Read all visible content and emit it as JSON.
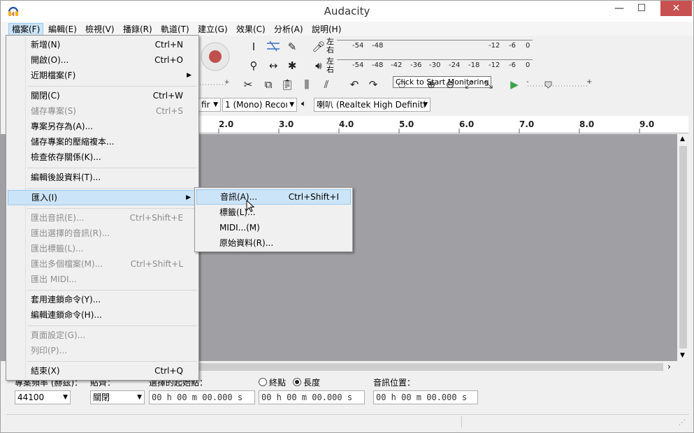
{
  "app": {
    "title": "Audacity"
  },
  "menubar": [
    {
      "label": "檔案(F)"
    },
    {
      "label": "編輯(E)"
    },
    {
      "label": "檢視(V)"
    },
    {
      "label": "播錄(R)"
    },
    {
      "label": "軌道(T)"
    },
    {
      "label": "建立(G)"
    },
    {
      "label": "效果(C)"
    },
    {
      "label": "分析(A)"
    },
    {
      "label": "說明(H)"
    }
  ],
  "file_menu": [
    {
      "label": "新增(N)",
      "shortcut": "Ctrl+N"
    },
    {
      "label": "開啟(O)...",
      "shortcut": "Ctrl+O"
    },
    {
      "label": "近期檔案(F)",
      "shortcut": ""
    },
    {
      "label": "關閉(C)",
      "shortcut": "Ctrl+W"
    },
    {
      "label": "儲存專案(S)",
      "shortcut": "Ctrl+S"
    },
    {
      "label": "專案另存為(A)...",
      "shortcut": ""
    },
    {
      "label": "儲存專案的壓縮複本...",
      "shortcut": ""
    },
    {
      "label": "檢查依存關係(K)...",
      "shortcut": ""
    },
    {
      "label": "編輯後設資料(T)...",
      "shortcut": ""
    },
    {
      "label": "匯入(I)",
      "shortcut": ""
    },
    {
      "label": "匯出音訊(E)...",
      "shortcut": "Ctrl+Shift+E"
    },
    {
      "label": "匯出選擇的音訊(R)...",
      "shortcut": ""
    },
    {
      "label": "匯出標籤(L)...",
      "shortcut": ""
    },
    {
      "label": "匯出多個檔案(M)...",
      "shortcut": "Ctrl+Shift+L"
    },
    {
      "label": "匯出 MIDI...",
      "shortcut": ""
    },
    {
      "label": "套用連鎖命令(Y)...",
      "shortcut": ""
    },
    {
      "label": "編輯連鎖命令(H)...",
      "shortcut": ""
    },
    {
      "label": "頁面設定(G)...",
      "shortcut": ""
    },
    {
      "label": "列印(P)...",
      "shortcut": ""
    },
    {
      "label": "結束(X)",
      "shortcut": "Ctrl+Q"
    }
  ],
  "import_submenu": [
    {
      "label": "音訊(A)...",
      "shortcut": "Ctrl+Shift+I"
    },
    {
      "label": "標籤(L)...",
      "shortcut": ""
    },
    {
      "label": "MIDI...(M)",
      "shortcut": ""
    },
    {
      "label": "原始資料(R)...",
      "shortcut": ""
    }
  ],
  "meters": {
    "record_lr": "左\n右",
    "play_lr": "左\n右",
    "record_ticks": [
      "-54",
      "-48",
      "-12",
      "-6",
      "0"
    ],
    "play_ticks": [
      "-54",
      "-48",
      "-42",
      "-36",
      "-30",
      "-24",
      "-18",
      "-12",
      "-6",
      "0"
    ],
    "tooltip": "Click to Start Monitoring"
  },
  "device": {
    "host_partial": "fir",
    "channels": "1 (Mono) Recoı",
    "output": "喇叭 (Realtek High Definiti"
  },
  "ruler": [
    "2.0",
    "3.0",
    "4.0",
    "5.0",
    "6.0",
    "7.0",
    "8.0",
    "9.0"
  ],
  "selection_bar": {
    "rate_label": "專案頻率 (赫茲)：",
    "rate_value": "44100",
    "snap_label": "貼齊：",
    "snap_value": "關閉",
    "sel_label": "選擇的起始點：",
    "end_radio": "終點",
    "length_radio": "長度",
    "pos_label": "音訊位置：",
    "time_start": "00 h 00 m 00.000 s",
    "time_len": "00 h 00 m 00.000 s",
    "time_pos": "00 h 00 m 00.000 s"
  }
}
